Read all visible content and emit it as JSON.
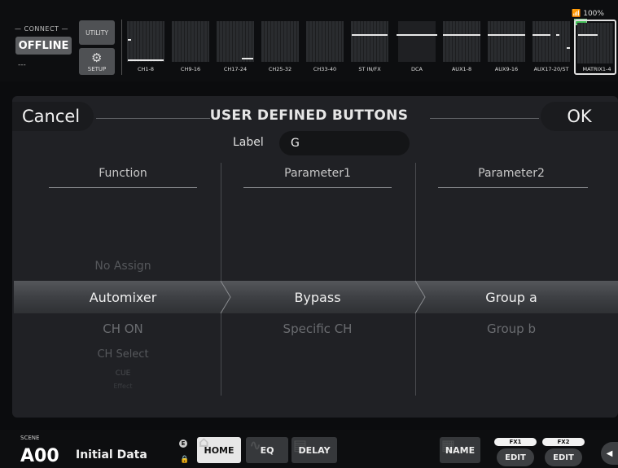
{
  "status": {
    "battery": "100%"
  },
  "connect": {
    "label": "CONNECT",
    "state": "OFFLINE",
    "sub": "---"
  },
  "buttons": {
    "utility": "UTILITY",
    "setup": "SETUP"
  },
  "banks": [
    {
      "label": "CH1-8"
    },
    {
      "label": "CH9-16"
    },
    {
      "label": "CH17-24"
    },
    {
      "label": "CH25-32"
    },
    {
      "label": "CH33-40"
    },
    {
      "label": "ST IN/FX"
    },
    {
      "label": "DCA"
    },
    {
      "label": "AUX1-8"
    },
    {
      "label": "AUX9-16"
    },
    {
      "label": "AUX17-20/ST"
    },
    {
      "label": "MATRIX1-4"
    }
  ],
  "dialog": {
    "title": "USER DEFINED BUTTONS",
    "cancel": "Cancel",
    "ok": "OK",
    "label_caption": "Label",
    "label_value": "G",
    "columns": {
      "function": "Function",
      "parameter1": "Parameter1",
      "parameter2": "Parameter2"
    },
    "function_items": {
      "above": "No Assign",
      "selected": "Automixer",
      "below1": "CH ON",
      "below2": "CH Select",
      "below3": "CUE",
      "below4": "Effect"
    },
    "parameter1_items": {
      "selected": "Bypass",
      "below1": "Specific CH"
    },
    "parameter2_items": {
      "selected": "Group a",
      "below1": "Group b"
    }
  },
  "scene": {
    "label": "SCENE",
    "number": "A00",
    "name": "Initial Data"
  },
  "tabs": {
    "home": "HOME",
    "eq": "EQ",
    "delay": "DELAY",
    "name": "NAME"
  },
  "fx": {
    "fx1": "FX1",
    "fx2": "FX2",
    "edit": "EDIT"
  },
  "colors": {
    "accent": "#e7e7e7",
    "panel": "#202125",
    "selected_band": "#4a4c50",
    "battery": "#46c25a"
  }
}
